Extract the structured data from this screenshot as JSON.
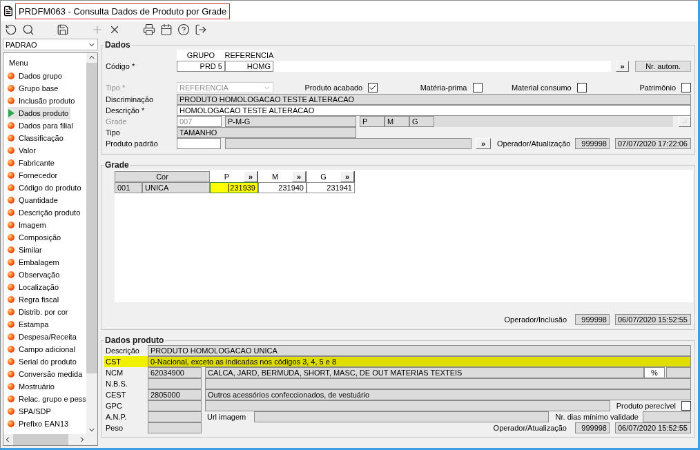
{
  "window": {
    "title": "PRDFM063 - Consulta Dados de Produto por Grade"
  },
  "toolbar": {
    "groups": [
      {
        "buttons": [
          {
            "kind": "undo",
            "disabled": false
          },
          {
            "kind": "search",
            "disabled": false
          }
        ]
      },
      {
        "buttons": [
          {
            "kind": "save",
            "disabled": false
          }
        ]
      },
      {
        "buttons": [
          {
            "kind": "add",
            "disabled": true
          },
          {
            "kind": "delete",
            "disabled": false
          }
        ]
      },
      {
        "buttons": [
          {
            "kind": "print",
            "disabled": false
          },
          {
            "kind": "calendar",
            "disabled": false
          },
          {
            "kind": "help",
            "disabled": false
          },
          {
            "kind": "exit",
            "disabled": false
          }
        ]
      }
    ]
  },
  "sidebar": {
    "profile": "PADRAO",
    "menu_title": "Menu",
    "items": [
      {
        "label": "Dados grupo",
        "selected": false
      },
      {
        "label": "Grupo base",
        "selected": false
      },
      {
        "label": "Inclusão produto",
        "selected": false
      },
      {
        "label": "Dados produto",
        "selected": true
      },
      {
        "label": "Dados para filial",
        "selected": false
      },
      {
        "label": "Classificação",
        "selected": false
      },
      {
        "label": "Valor",
        "selected": false
      },
      {
        "label": "Fabricante",
        "selected": false
      },
      {
        "label": "Fornecedor",
        "selected": false
      },
      {
        "label": "Código do produto",
        "selected": false
      },
      {
        "label": "Quantidade",
        "selected": false
      },
      {
        "label": "Descrição produto",
        "selected": false
      },
      {
        "label": "Imagem",
        "selected": false
      },
      {
        "label": "Composição",
        "selected": false
      },
      {
        "label": "Similar",
        "selected": false
      },
      {
        "label": "Embalagem",
        "selected": false
      },
      {
        "label": "Observação",
        "selected": false
      },
      {
        "label": "Localização",
        "selected": false
      },
      {
        "label": "Regra fiscal",
        "selected": false
      },
      {
        "label": "Distrib. por cor",
        "selected": false
      },
      {
        "label": "Estampa",
        "selected": false
      },
      {
        "label": "Despesa/Receita",
        "selected": false
      },
      {
        "label": "Campo adicional",
        "selected": false
      },
      {
        "label": "Serial do produto",
        "selected": false
      },
      {
        "label": "Conversão medida",
        "selected": false
      },
      {
        "label": "Mostruário",
        "selected": false
      },
      {
        "label": "Relac. grupo e pess",
        "selected": false
      },
      {
        "label": "SPA/SDP",
        "selected": false
      },
      {
        "label": "Prefixo EAN13",
        "selected": false
      }
    ]
  },
  "dados": {
    "title": "Dados",
    "codigo": {
      "label": "Código *",
      "columns": [
        "GRUPO",
        "REFERENCIA"
      ],
      "values": [
        "PRD 5",
        "HOMG"
      ],
      "more_button": "»",
      "auto_button": "Nr. autom."
    },
    "tipo": {
      "label": "Tipo *",
      "disabled": true,
      "value": "REFERENCIA"
    },
    "flags": [
      {
        "label": "Produto acabado",
        "checked": true
      },
      {
        "label": "Matéria-prima",
        "checked": false
      },
      {
        "label": "Material consumo",
        "checked": false
      },
      {
        "label": "Patrimônio",
        "checked": false
      }
    ],
    "discriminacao": {
      "label": "Discriminação",
      "value": "PRODUTO HOMOLOGACAO TESTE ALTERACAO"
    },
    "descricao": {
      "label": "Descrição *",
      "value": "HOMOLOGACAO TESTE ALTERACAO"
    },
    "grade": {
      "label": "Grade",
      "disabled": true,
      "code": "007",
      "name": "P-M-G",
      "sizes": [
        "P",
        "M",
        "G"
      ]
    },
    "tipo_grade": {
      "label": "Tipo",
      "value": "TAMANHO"
    },
    "produto_padrao": {
      "label": "Produto padrão",
      "more_button": "»"
    },
    "atualizacao": {
      "label": "Operador/Atualização",
      "operator": "999998",
      "timestamp": "07/07/2020 17:22:06"
    }
  },
  "grade": {
    "title": "Grade",
    "color_header": "Cor",
    "sizes": [
      "P",
      "M",
      "G"
    ],
    "size_button": "»",
    "rows": [
      {
        "code": "001",
        "color_name": "UNICA",
        "values": [
          {
            "text": "231939",
            "selected": true
          },
          {
            "text": "231940",
            "selected": false
          },
          {
            "text": "231941",
            "selected": false
          }
        ]
      }
    ],
    "inclusao": {
      "label": "Operador/Inclusão",
      "operator": "999998",
      "timestamp": "06/07/2020 15:52:55"
    }
  },
  "dados_produto": {
    "title": "Dados produto",
    "descricao": {
      "label": "Descrição",
      "value": "PRODUTO HOMOLOGACAO UNICA"
    },
    "cst": {
      "label": "CST",
      "value": "0-Nacional, exceto as indicadas nos códigos 3, 4, 5 e 8",
      "highlighted": true
    },
    "ncm": {
      "label": "NCM",
      "code": "62034900",
      "description": "CALCA, JARD, BERMUDA, SHORT, MASC, DE OUT MATERIAS TEXTEIS",
      "percent": "%"
    },
    "nbs": {
      "label": "N.B.S."
    },
    "cest": {
      "label": "CEST",
      "code": "2805000",
      "description": "Outros acessórios confeccionados, de vestuário"
    },
    "gpc": {
      "label": "GPC"
    },
    "perecivel": {
      "label": "Produto perecível",
      "checked": false
    },
    "anp": {
      "label": "A.N.P."
    },
    "url": {
      "label": "Url imagem"
    },
    "validade": {
      "label": "Nr. dias mínimo validade"
    },
    "peso": {
      "label": "Peso"
    },
    "atualizacao": {
      "label": "Operador/Atualização",
      "operator": "999998",
      "timestamp": "06/07/2020 15:52:55"
    }
  }
}
